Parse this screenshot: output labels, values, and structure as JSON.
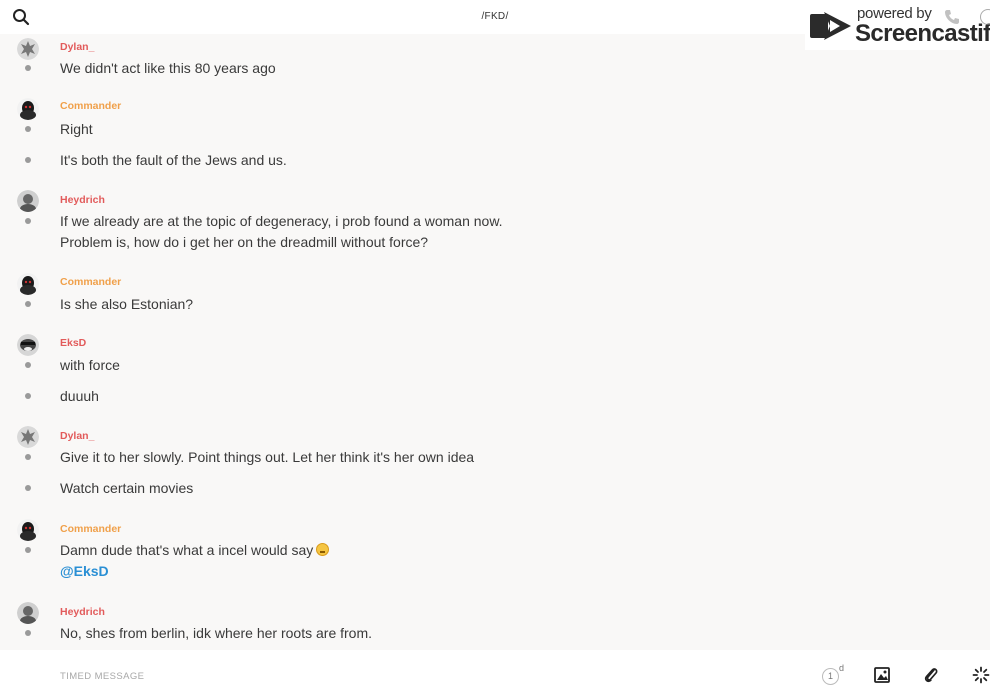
{
  "header": {
    "channel_title": "/FKD/",
    "watermark_powered": "powered by",
    "watermark_brand": "Screencastify"
  },
  "composer": {
    "placeholder": "TIMED MESSAGE",
    "timer_value": "1",
    "timer_unit": "d"
  },
  "colors": {
    "author_red": "#e25b5b",
    "author_orange": "#f0a04a",
    "mention_blue": "#2a8fd4"
  },
  "messages": [
    {
      "author": "Dylan_",
      "lines": [
        "We didn't act like this 80 years ago"
      ]
    },
    {
      "author": "Commander",
      "lines": [
        "Right",
        "It's both the fault of the Jews and us."
      ]
    },
    {
      "author": "Heydrich",
      "lines": [
        "If we already are at the topic of degeneracy, i prob found a woman now.",
        "Problem is, how do i get her on the dreadmill without force?"
      ]
    },
    {
      "author": "Commander",
      "lines": [
        "Is she also Estonian?"
      ]
    },
    {
      "author": "EksD",
      "lines": [
        "with force",
        "duuuh"
      ]
    },
    {
      "author": "Dylan_",
      "lines": [
        "Give it to her slowly. Point things out. Let her think it's her own idea",
        "Watch certain movies"
      ]
    },
    {
      "author": "Commander",
      "lines": [
        "Damn dude that's what a incel would say",
        "@EksD"
      ]
    },
    {
      "author": "Heydrich",
      "lines": [
        "No, shes from berlin, idk where her roots are from."
      ]
    }
  ]
}
